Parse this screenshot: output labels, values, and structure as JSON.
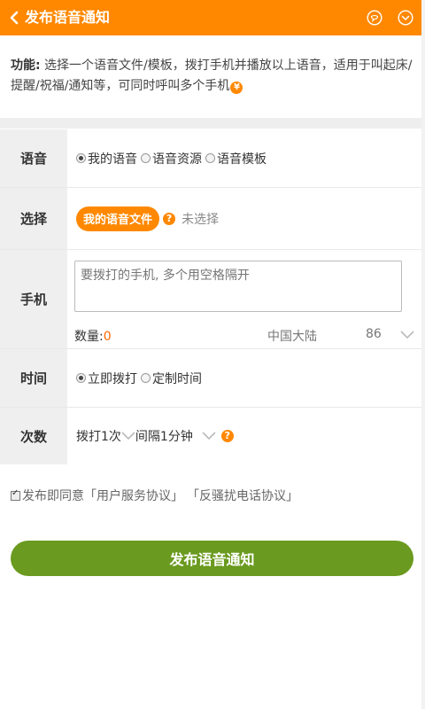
{
  "header": {
    "title": "发布语音通知",
    "back_icon": "chevron-left-icon",
    "message_icon": "message-circle-icon",
    "more_icon": "chevron-down-circle-icon"
  },
  "description": {
    "label": "功能:",
    "text": " 选择一个语音文件/模板，拨打手机并播放以上语音，适用于叫起床/提醒/祝福/通知等，可同时呼叫多个手机",
    "badge": "¥"
  },
  "form": {
    "voice": {
      "label": "语音",
      "options": [
        "我的语音",
        "语音资源",
        "语音模板"
      ],
      "selected": "我的语音"
    },
    "select": {
      "label": "选择",
      "button": "我的语音文件",
      "help": "?",
      "status": "未选择"
    },
    "phone": {
      "label": "手机",
      "placeholder": "要拨打的手机, 多个用空格隔开",
      "count_label": "数量:",
      "count_value": "0",
      "region": "中国大陆",
      "code": "86"
    },
    "time": {
      "label": "时间",
      "options": [
        "立即拨打",
        "定制时间"
      ],
      "selected": "立即拨打"
    },
    "times": {
      "label": "次数",
      "dial_value": "拨打1次",
      "interval_value": "间隔1分钟",
      "help": "?"
    }
  },
  "agreement": {
    "text": "发布即同意",
    "link1": "「用户服务协议」",
    "link2": "「反骚扰电话协议」",
    "checked": true
  },
  "submit": {
    "label": "发布语音通知"
  },
  "colors": {
    "accent": "#ff8800",
    "submit": "#6a9a1f"
  }
}
